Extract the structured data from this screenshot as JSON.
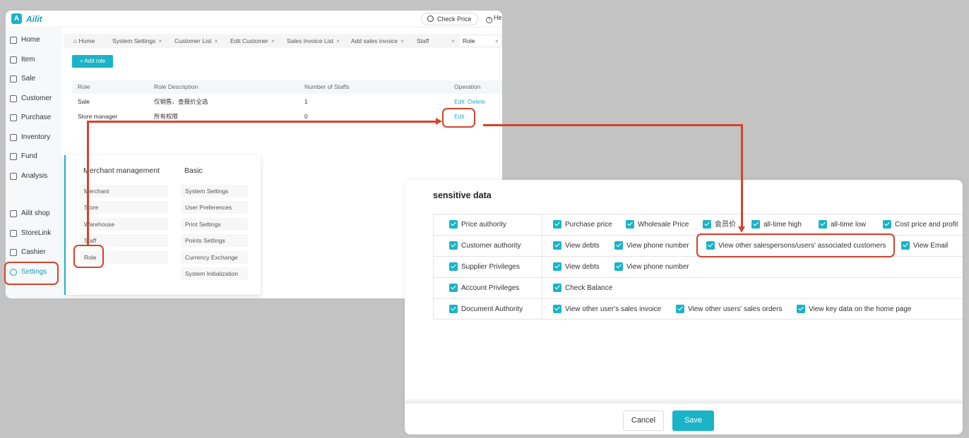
{
  "app": {
    "brand_initial": "A",
    "brand_name": "Ailit",
    "check_price": "Check Price",
    "help": "Hel"
  },
  "sidebar": {
    "items": [
      {
        "label": "Home",
        "icon": "home-icon"
      },
      {
        "label": "Item",
        "icon": "item-icon"
      },
      {
        "label": "Sale",
        "icon": "sale-icon"
      },
      {
        "label": "Customer",
        "icon": "customer-icon"
      },
      {
        "label": "Purchase",
        "icon": "purchase-icon"
      },
      {
        "label": "Inventory",
        "icon": "inventory-icon"
      },
      {
        "label": "Fund",
        "icon": "fund-icon"
      },
      {
        "label": "Analysis",
        "icon": "analysis-icon"
      },
      {
        "label": "Ailit shop",
        "icon": "shop-icon"
      },
      {
        "label": "StoreLink",
        "icon": "storelink-icon"
      },
      {
        "label": "Cashier",
        "icon": "cashier-icon"
      },
      {
        "label": "Settings",
        "icon": "gear-icon"
      }
    ]
  },
  "tabs": [
    {
      "label": "Home"
    },
    {
      "label": "System Settings"
    },
    {
      "label": "Customer List"
    },
    {
      "label": "Edit Customer"
    },
    {
      "label": "Sales Invoice List"
    },
    {
      "label": "Add sales invoice"
    },
    {
      "label": "Staff"
    },
    {
      "label": "Role"
    }
  ],
  "tab_close": "×",
  "add_role": "+ Add role",
  "role_table": {
    "headers": [
      "Role",
      "Role Description",
      "Number of Staffs",
      "Operation"
    ],
    "rows": [
      {
        "role": "Sale",
        "description": "仅销售、查报价全选",
        "staffs": "1",
        "ops": [
          "Edit",
          "Delete"
        ]
      },
      {
        "role": "Store manager",
        "description": "所有权限",
        "staffs": "0",
        "ops": [
          "Edit"
        ]
      }
    ]
  },
  "menu": {
    "col1_title": "Merchant management",
    "col1_items": [
      "Merchant",
      "Store",
      "Warehouse",
      "Staff",
      "Role"
    ],
    "col2_title": "Basic",
    "col2_items": [
      "System Settings",
      "User Preferences",
      "Print Settings",
      "Points Settings",
      "Currency Exchange",
      "System Initialization"
    ]
  },
  "panel": {
    "title": "sensitive data",
    "rows": [
      {
        "category": "Price authority",
        "items": [
          "Purchase price",
          "Wholesale Price",
          "会员价",
          "all-time high",
          "all-time low",
          "Cost price and profit"
        ]
      },
      {
        "category": "Customer authority",
        "items": [
          "View debts",
          "View phone number",
          "View other salespersons/users' associated customers",
          "View Email"
        ]
      },
      {
        "category": "Supplier Privileges",
        "items": [
          "View debts",
          "View phone number"
        ]
      },
      {
        "category": "Account Privileges",
        "items": [
          "Check Balance"
        ]
      },
      {
        "category": "Document Authority",
        "items": [
          "View other user's sales invoice",
          "View other users' sales orders",
          "View key data on the home page"
        ]
      }
    ],
    "cancel": "Cancel",
    "save": "Save"
  },
  "colors": {
    "accent": "#1bb3c7",
    "highlight": "#d4432c"
  }
}
